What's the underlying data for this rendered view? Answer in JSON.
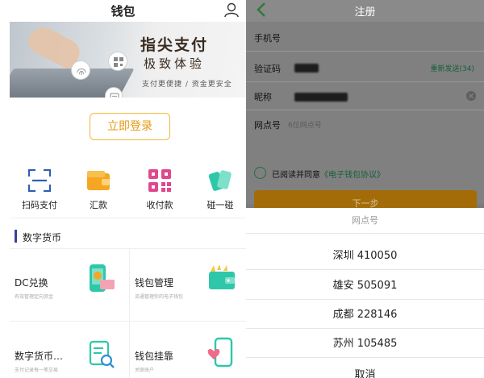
{
  "left": {
    "title": "钱包",
    "banner": {
      "headline": "指尖支付",
      "headline_sub": "极致体验",
      "tagline": "支付更便捷 / 资金更安全"
    },
    "login_label": "立即登录",
    "quick_actions": [
      {
        "label": "扫码支付",
        "icon": "scan-icon"
      },
      {
        "label": "汇款",
        "icon": "wallet-icon"
      },
      {
        "label": "收付款",
        "icon": "qr-code-icon"
      },
      {
        "label": "碰一碰",
        "icon": "tap-cards-icon"
      }
    ],
    "section_title": "数字货币",
    "cards": [
      {
        "title": "DC兑换",
        "subtitle": "有效管理定向资金",
        "icon": "exchange-phone-icon"
      },
      {
        "title": "钱包管理",
        "subtitle": "流通管理你的电子钱包",
        "icon": "wallet-manage-icon"
      },
      {
        "title": "数字货币…",
        "subtitle": "支付记录每一笔交易",
        "icon": "record-search-icon"
      },
      {
        "title": "钱包挂靠",
        "subtitle": "关联账户",
        "icon": "heart-phone-icon"
      }
    ],
    "colors": {
      "accent": "#f0b93c",
      "section_bar": "#3a3fa0"
    }
  },
  "right": {
    "title": "注册",
    "form": {
      "phone_label": "手机号",
      "code_label": "验证码",
      "resend_label": "重新发送(34)",
      "nickname_label": "昵称",
      "branch_label": "网点号",
      "branch_placeholder": "6位网点号"
    },
    "agreement": {
      "text": "已阅读并同意",
      "link": "《电子钱包协议》"
    },
    "next_label": "下一步",
    "picker": {
      "header": "网点号",
      "options": [
        "深圳 410050",
        "雄安 505091",
        "成都 228146",
        "苏州 105485"
      ],
      "cancel_label": "取消"
    },
    "colors": {
      "next_button": "#a36c08",
      "link": "#165f3c"
    }
  }
}
